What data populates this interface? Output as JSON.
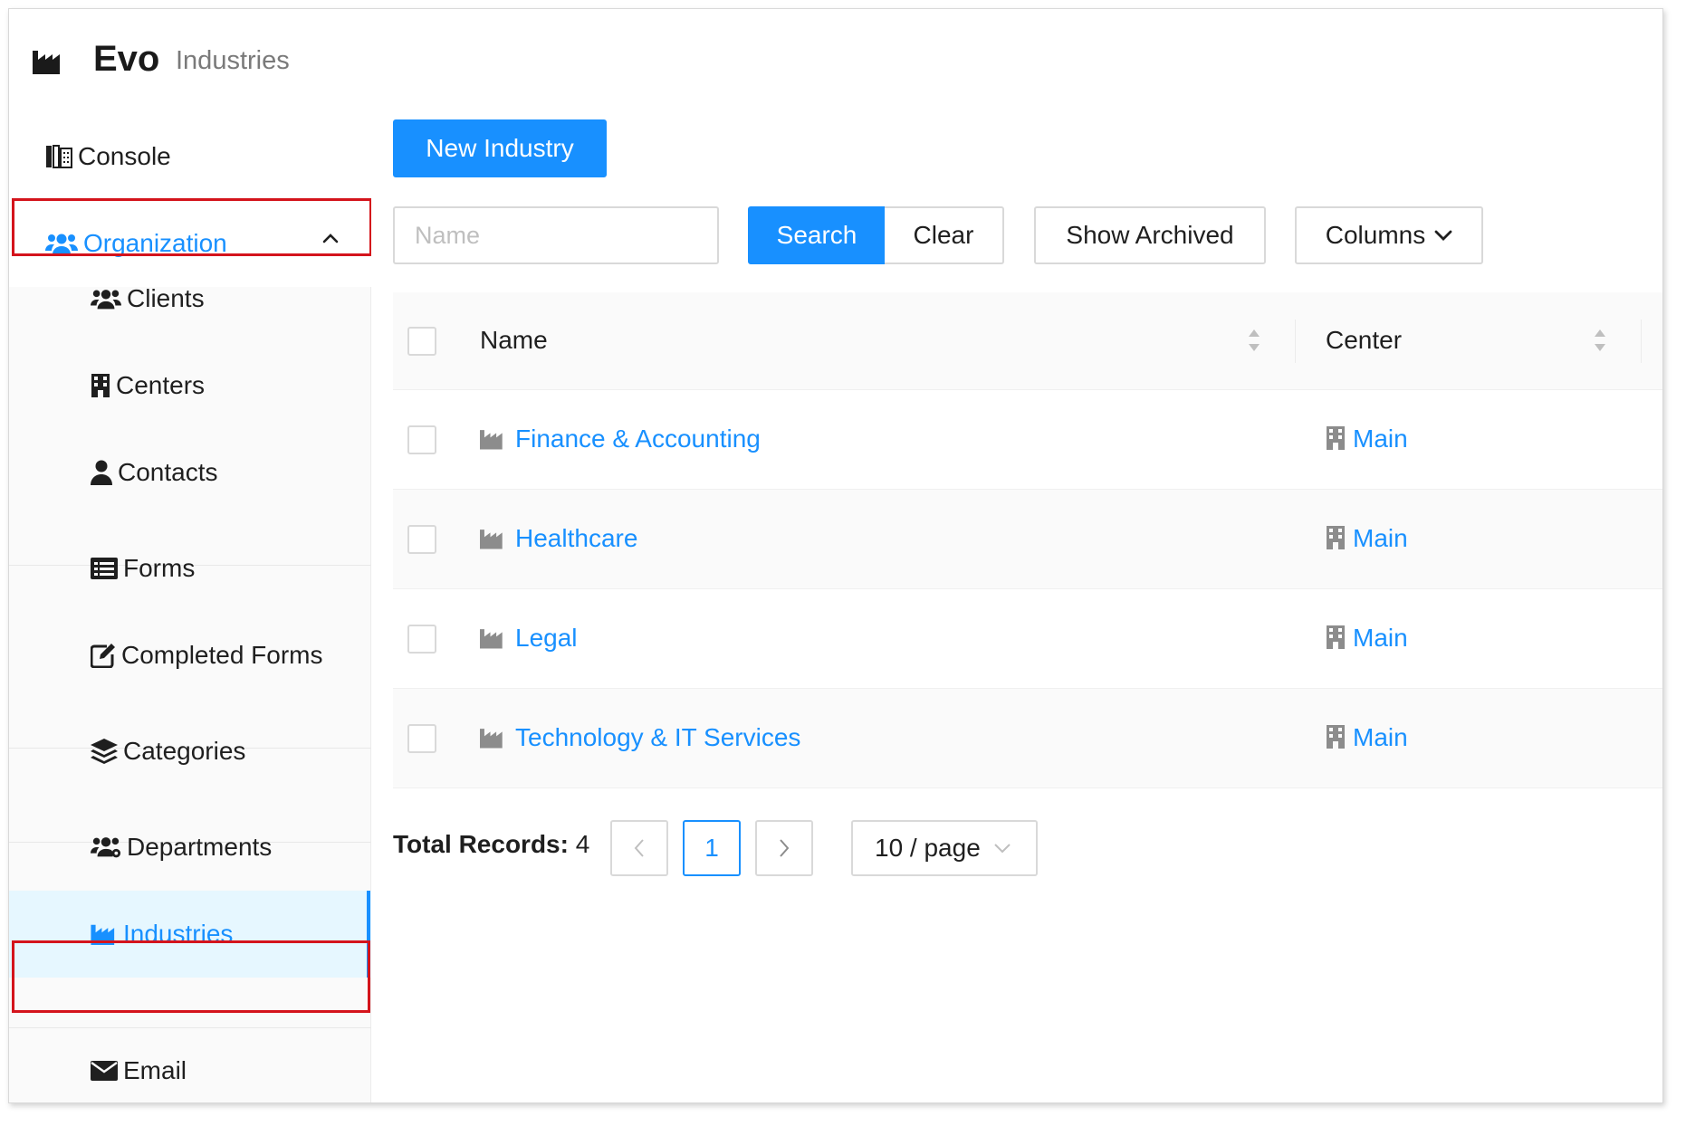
{
  "header": {
    "logo_icon": "industry-icon",
    "app_title": "Evo",
    "page_crumb": "Industries"
  },
  "sidebar": {
    "items": [
      {
        "label": "Console",
        "icon": "console-icon"
      },
      {
        "label": "Organization",
        "icon": "users-icon",
        "expanded": true
      },
      {
        "label": "Clients",
        "icon": "users-icon"
      },
      {
        "label": "Centers",
        "icon": "building-icon"
      },
      {
        "label": "Contacts",
        "icon": "user-icon"
      },
      {
        "label": "Forms",
        "icon": "list-icon"
      },
      {
        "label": "Completed Forms",
        "icon": "edit-icon"
      },
      {
        "label": "Categories",
        "icon": "layers-icon"
      },
      {
        "label": "Departments",
        "icon": "users-cog-icon"
      },
      {
        "label": "Industries",
        "icon": "industry-icon",
        "active": true
      },
      {
        "label": "Email",
        "icon": "envelope-icon"
      }
    ]
  },
  "toolbar": {
    "new_button": "New Industry",
    "name_placeholder": "Name",
    "search_button": "Search",
    "clear_button": "Clear",
    "show_archived_button": "Show Archived",
    "columns_button": "Columns"
  },
  "table": {
    "columns": [
      "Name",
      "Center"
    ],
    "rows": [
      {
        "name": "Finance & Accounting",
        "center": "Main"
      },
      {
        "name": "Healthcare",
        "center": "Main"
      },
      {
        "name": "Legal",
        "center": "Main"
      },
      {
        "name": "Technology & IT Services",
        "center": "Main"
      }
    ]
  },
  "pagination": {
    "total_label": "Total Records:",
    "total_value": "4",
    "current_page": "1",
    "page_size": "10 / page"
  },
  "colors": {
    "primary": "#1890ff",
    "highlight": "#d4141c"
  }
}
